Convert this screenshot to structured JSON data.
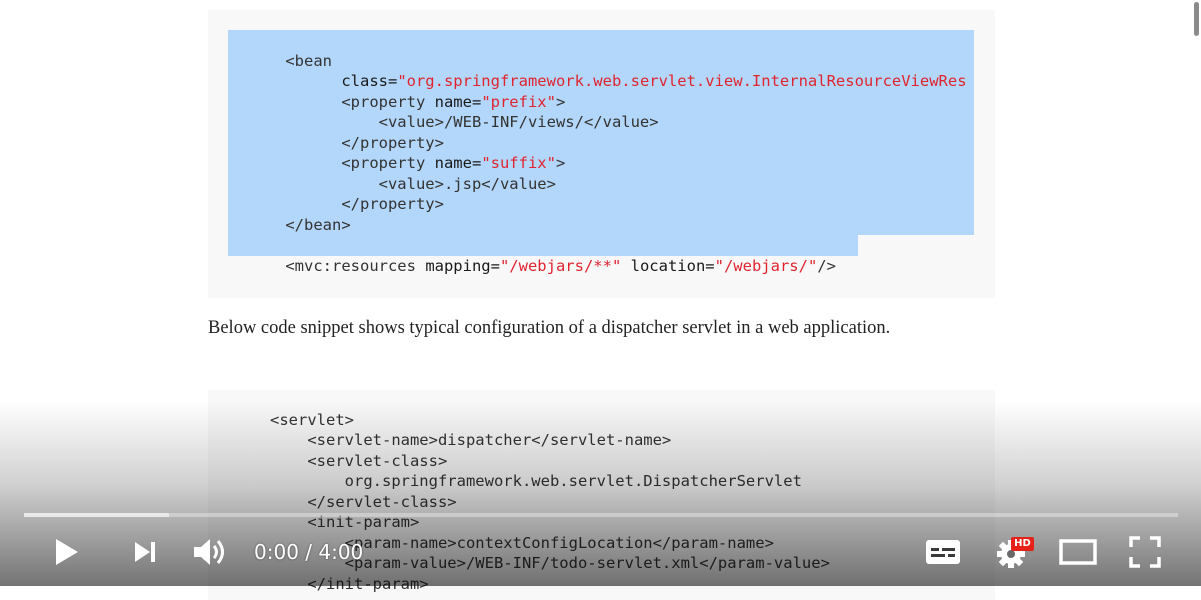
{
  "code_block_1": {
    "lines": [
      [
        "<bean",
        "",
        "",
        ""
      ],
      [
        "      class=",
        "\"org.springframework.web.servlet.view.InternalResourceViewRes",
        "",
        ""
      ],
      [
        "      <property ",
        "name=",
        "\"prefix\"",
        ">"
      ],
      [
        "          <value>/WEB-INF/views/</value>",
        "",
        "",
        ""
      ],
      [
        "      </property>",
        "",
        "",
        ""
      ],
      [
        "      <property ",
        "name=",
        "\"suffix\"",
        ">"
      ],
      [
        "          <value>.jsp</value>",
        "",
        "",
        ""
      ],
      [
        "      </property>",
        "",
        "",
        ""
      ],
      [
        "</bean>",
        "",
        "",
        ""
      ],
      [
        "",
        "",
        "",
        ""
      ],
      [
        "<mvc:resources ",
        "mapping=",
        "\"/webjars/**\"",
        ""
      ],
      [
        " location=",
        "\"/webjars/\"",
        "/>",
        ""
      ]
    ]
  },
  "prose": {
    "text": "Below code snippet shows typical configuration of a dispatcher servlet in a web application."
  },
  "code_block_2": {
    "lines": [
      "<servlet>",
      "    <servlet-name>dispatcher</servlet-name>",
      "    <servlet-class>",
      "        org.springframework.web.servlet.DispatcherServlet",
      "    </servlet-class>",
      "    <init-param>",
      "        <param-name>contextConfigLocation</param-name>",
      "        <param-value>/WEB-INF/todo-servlet.xml</param-value>",
      "    </init-param>"
    ]
  },
  "player": {
    "time_display": "0:00 / 4:00",
    "current_time": "0:00",
    "duration": "4:00",
    "buffered_fraction": 0.126,
    "hd_badge": "HD",
    "icons": {
      "play": "play-icon",
      "next": "next-icon",
      "volume": "volume-icon",
      "subtitles": "subtitles-icon",
      "settings": "settings-gear-icon",
      "theater": "theater-mode-icon",
      "fullscreen": "fullscreen-icon"
    }
  }
}
